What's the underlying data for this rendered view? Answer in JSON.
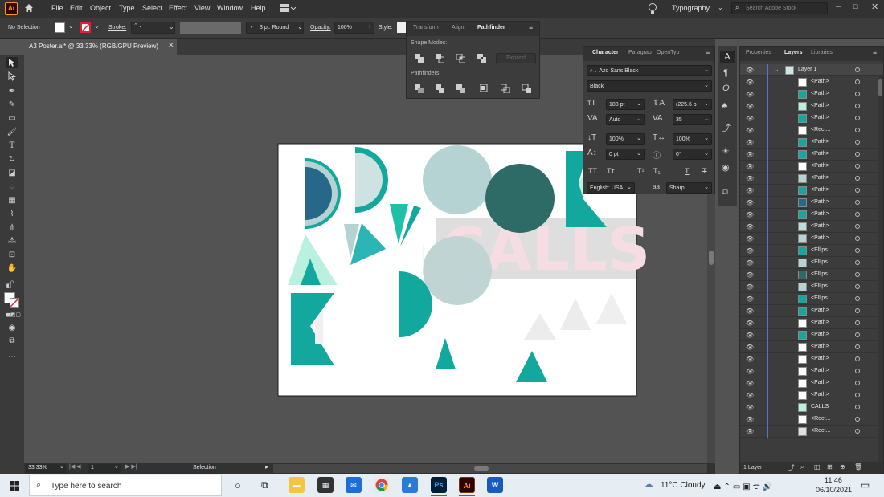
{
  "menubar": {
    "app_badge": "Ai",
    "items": [
      "File",
      "Edit",
      "Object",
      "Type",
      "Select",
      "Effect",
      "View",
      "Window",
      "Help"
    ],
    "workspace": "Typography",
    "search_placeholder": "Search Adobe Stock"
  },
  "control": {
    "selection": "No Selection",
    "stroke_label": "Stroke:",
    "brush": "3 pt. Round",
    "opacity_label": "Opacity:",
    "opacity_value": "100%",
    "style_label": "Style:"
  },
  "document": {
    "tab_title": "A3 Poster.ai* @ 33.33% (RGB/GPU Preview)"
  },
  "pathfinder_panel": {
    "tabs": [
      "Transform",
      "Align",
      "Pathfinder"
    ],
    "shape_modes_label": "Shape Modes:",
    "expand_label": "Expand",
    "pathfinders_label": "Pathfinders:"
  },
  "character_panel": {
    "tabs": [
      "Character",
      "Paragrap",
      "OpenTyp"
    ],
    "font_family": "Azo Sans Black",
    "font_style": "Black",
    "font_size": "188 pt",
    "leading": "(225.6 p",
    "kerning": "Auto",
    "tracking": "35",
    "vscale": "100%",
    "hscale": "100%",
    "baseline": "0 pt",
    "rotation": "0°",
    "language": "English: USA",
    "aa_label": "a",
    "antialias": "Sharp"
  },
  "layers_panel": {
    "tabs": [
      "Properties",
      "Layers",
      "Libraries"
    ],
    "layer_name": "Layer 1",
    "rows": [
      "<Path>",
      "<Path>",
      "<Path>",
      "<Path>",
      "<Rect...",
      "<Path>",
      "<Path>",
      "<Path>",
      "<Path>",
      "<Path>",
      "<Path>",
      "<Path>",
      "<Path>",
      "<Path>",
      "<Ellips...",
      "<Ellips...",
      "<Ellips...",
      "<Ellips...",
      "<Ellips...",
      "<Path>",
      "<Path>",
      "<Path>",
      "<Path>",
      "<Path>",
      "<Path>",
      "<Path>",
      "<Path>",
      "CALLS",
      "<Rect...",
      "<Rect..."
    ],
    "footer": "1 Layer"
  },
  "artboard": {
    "overlay_text": "CALLS"
  },
  "status": {
    "zoom": "33.33%",
    "page": "1",
    "tool": "Selection"
  },
  "taskbar": {
    "search_placeholder": "Type here to search",
    "weather": "11°C  Cloudy",
    "time": "11:46",
    "date": "06/10/2021",
    "apps": [
      "Ps",
      "Ai"
    ]
  },
  "colors": {
    "teal": "#13a89e",
    "dark_teal": "#2f6b66",
    "light_teal": "#b5d3d2",
    "mint": "#b9f0e0",
    "navy_teal": "#27688a",
    "pink": "#f6dde3",
    "grey_tri": "#ececec"
  }
}
